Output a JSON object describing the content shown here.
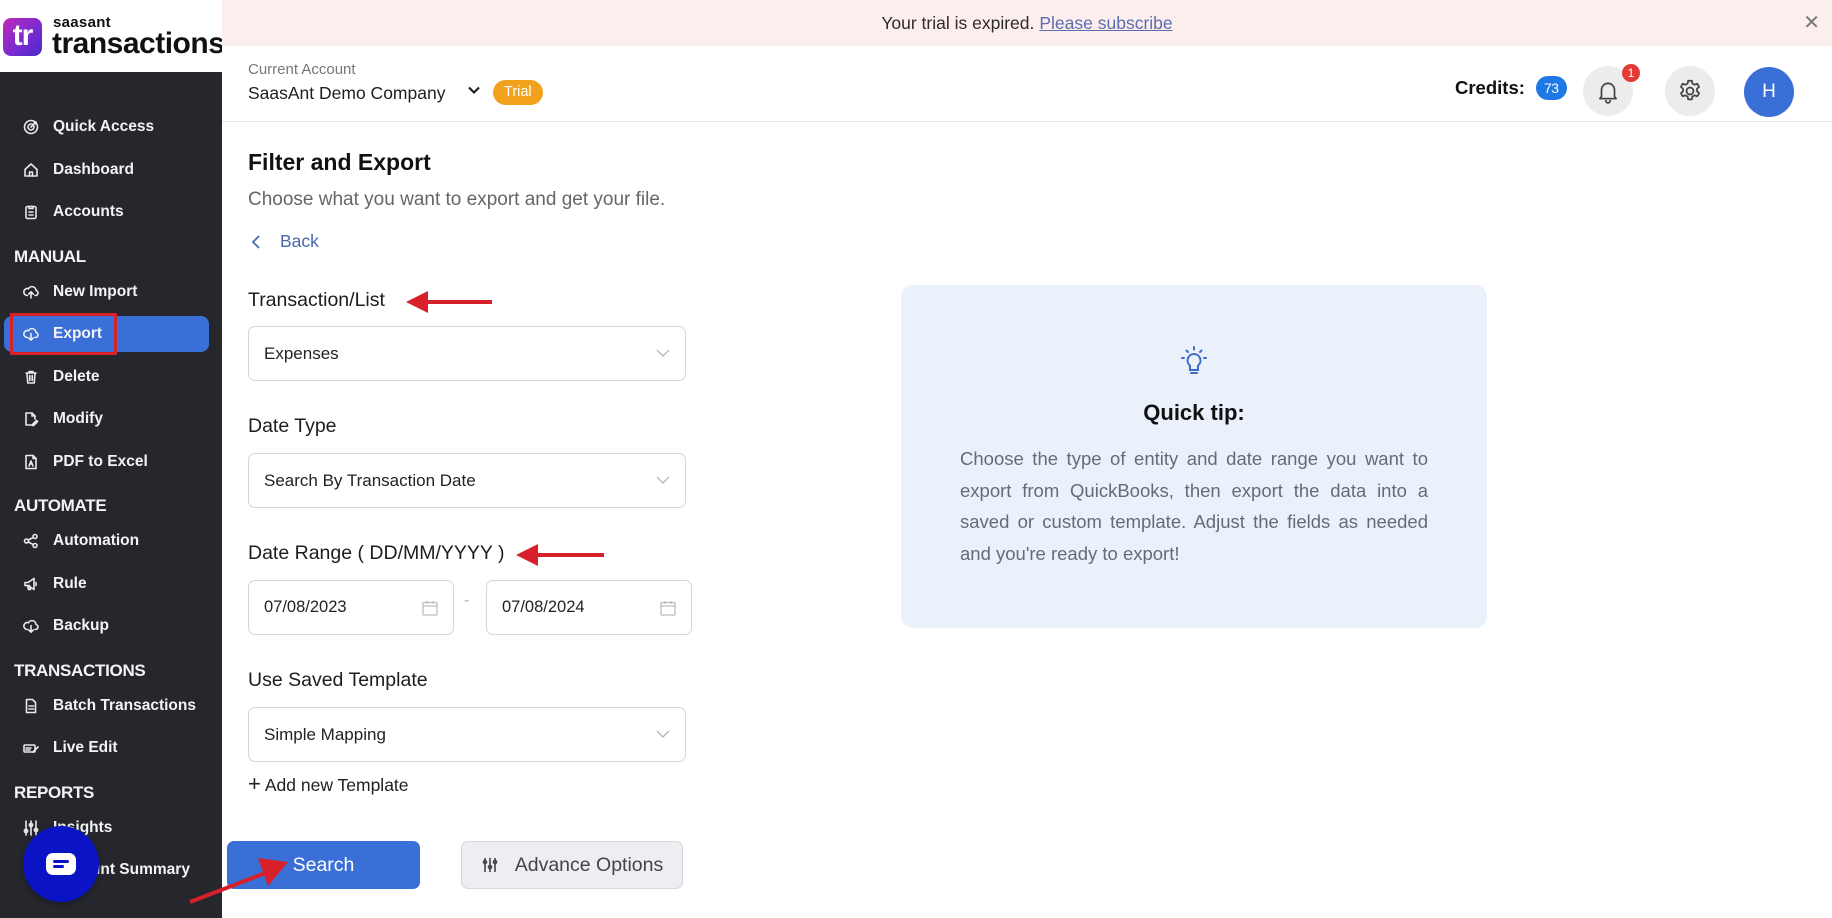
{
  "banner": {
    "message": "Your trial is expired.",
    "link": "Please subscribe",
    "close_icon": "close-icon"
  },
  "logo": {
    "mark": "tr",
    "brand_small": "saasant",
    "brand_big": "transactions"
  },
  "sidebar": {
    "top_items": [
      {
        "label": "Quick Access",
        "icon": "target-icon"
      },
      {
        "label": "Dashboard",
        "icon": "home-icon"
      },
      {
        "label": "Accounts",
        "icon": "clipboard-icon"
      }
    ],
    "sections": [
      {
        "title": "MANUAL",
        "items": [
          {
            "label": "New Import",
            "icon": "cloud-upload-icon"
          },
          {
            "label": "Export",
            "icon": "cloud-download-icon",
            "active": true
          },
          {
            "label": "Delete",
            "icon": "trash-icon"
          },
          {
            "label": "Modify",
            "icon": "file-edit-icon"
          },
          {
            "label": "PDF to Excel",
            "icon": "pdf-file-icon"
          }
        ]
      },
      {
        "title": "AUTOMATE",
        "items": [
          {
            "label": "Automation",
            "icon": "share-nodes-icon"
          },
          {
            "label": "Rule",
            "icon": "megaphone-icon"
          },
          {
            "label": "Backup",
            "icon": "cloud-download-icon"
          }
        ]
      },
      {
        "title": "TRANSACTIONS",
        "items": [
          {
            "label": "Batch Transactions",
            "icon": "document-icon"
          },
          {
            "label": "Live Edit",
            "icon": "pencil-lines-icon"
          }
        ]
      },
      {
        "title": "REPORTS",
        "items": [
          {
            "label": "Insights",
            "icon": "sliders-icon"
          },
          {
            "label": "Account Summary",
            "icon": "summary-icon"
          }
        ]
      }
    ]
  },
  "header": {
    "account_label": "Current Account",
    "account_name": "SaasAnt Demo Company",
    "plan_badge": "Trial",
    "credits_label": "Credits:",
    "credits_value": "73",
    "notification_count": "1",
    "avatar_initial": "H"
  },
  "main": {
    "title": "Filter and Export",
    "subtitle": "Choose what you want to export and get your file.",
    "back_label": "Back",
    "transaction_list": {
      "label": "Transaction/List",
      "value": "Expenses"
    },
    "date_type": {
      "label": "Date Type",
      "value": "Search By Transaction Date"
    },
    "date_range": {
      "label": "Date Range ( DD/MM/YYYY )",
      "from": "07/08/2023",
      "separator": "-",
      "to": "07/08/2024"
    },
    "template": {
      "label": "Use Saved Template",
      "value": "Simple Mapping"
    },
    "add_template": "Add new Template",
    "search_button": "Search",
    "advance_button": "Advance Options"
  },
  "tip": {
    "title": "Quick tip:",
    "text": "Choose the type of entity and date range you want to export from QuickBooks, then export the data into a saved or custom template. Adjust the fields as needed and you're ready to export!"
  },
  "colors": {
    "sidebar_bg": "#25272d",
    "accent": "#3b6fd8",
    "banner_bg": "#fdeeee",
    "trial_badge": "#f2a11c",
    "credits_badge": "#1e78e6",
    "tip_bg": "#ebf1fb",
    "annotation_red": "#d8202a"
  }
}
